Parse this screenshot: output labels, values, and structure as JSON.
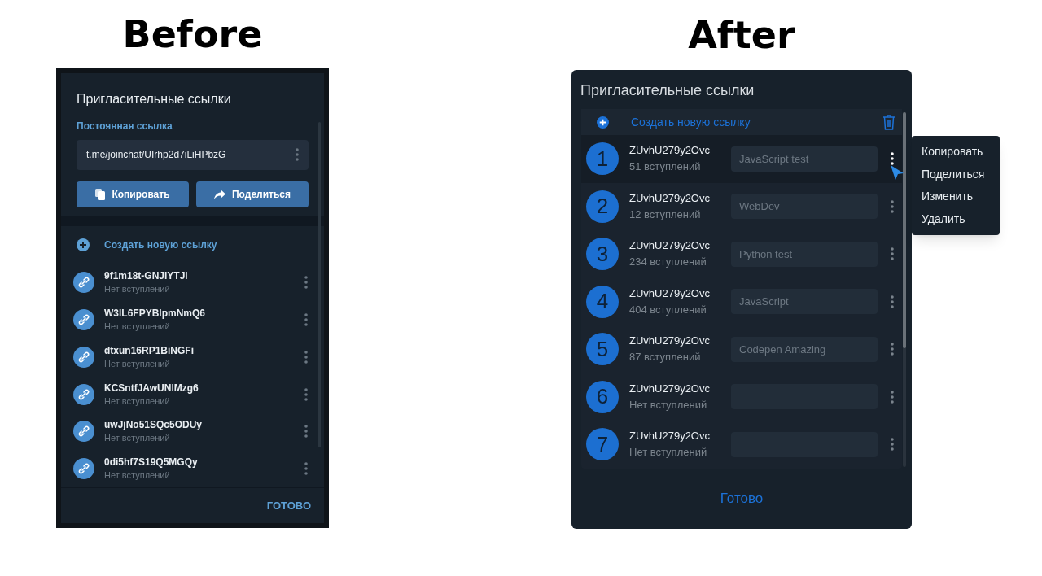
{
  "before": {
    "heading": "Before",
    "title": "Пригласительные ссылки",
    "permanent_label": "Постоянная ссылка",
    "permanent_link": "t.me/joinchat/UIrhp2d7iLiHPbzG",
    "buttons": [
      "Копировать",
      "Поделиться"
    ],
    "create_link": "Создать новую ссылку",
    "links": [
      {
        "code": "9f1m18t-GNJiYTJi",
        "joins": "Нет вступлений"
      },
      {
        "code": "W3lL6FPYBIpmNmQ6",
        "joins": "Нет вступлений"
      },
      {
        "code": "dtxun16RP1BiNGFi",
        "joins": "Нет вступлений"
      },
      {
        "code": "KCSntfJAwUNlMzg6",
        "joins": "Нет вступлений"
      },
      {
        "code": "uwJjNo51SQc5ODUy",
        "joins": "Нет вступлений"
      },
      {
        "code": "0di5hf7S19Q5MGQy",
        "joins": "Нет вступлений"
      }
    ],
    "done": "ГОТОВО"
  },
  "after": {
    "heading": "After",
    "title": "Пригласительные ссылки",
    "create_link": "Создать новую ссылку",
    "links": [
      {
        "number": "1",
        "code": "ZUvhU279y2Ovc",
        "joins": "51 вступлений",
        "name": "JavaScript test",
        "selected": true
      },
      {
        "number": "2",
        "code": "ZUvhU279y2Ovc",
        "joins": "12 вступлений",
        "name": "WebDev",
        "selected": false
      },
      {
        "number": "3",
        "code": "ZUvhU279y2Ovc",
        "joins": "234 вступлений",
        "name": "Python test",
        "selected": false
      },
      {
        "number": "4",
        "code": "ZUvhU279y2Ovc",
        "joins": "404 вступлений",
        "name": "JavaScript",
        "selected": false
      },
      {
        "number": "5",
        "code": "ZUvhU279y2Ovc",
        "joins": "87 вступлений",
        "name": "Codepen Amazing",
        "selected": false
      },
      {
        "number": "6",
        "code": "ZUvhU279y2Ovc",
        "joins": "Нет вступлений",
        "selected": false
      },
      {
        "number": "7",
        "code": "ZUvhU279y2Ovc",
        "joins": "Нет вступлений",
        "selected": false
      }
    ],
    "context_menu": [
      "Копировать",
      "Поделиться",
      "Изменить",
      "Удалить"
    ],
    "done": "Готово"
  }
}
